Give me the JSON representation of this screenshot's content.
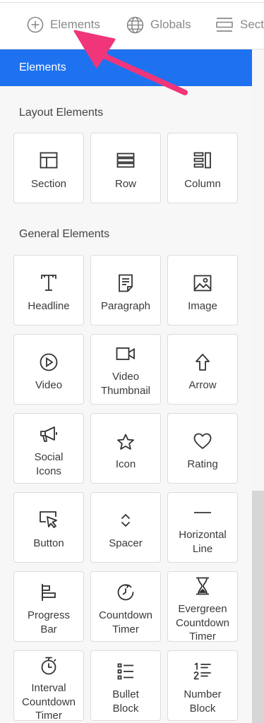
{
  "tabs": [
    {
      "label": "Elements",
      "icon": "plus-circle-icon"
    },
    {
      "label": "Globals",
      "icon": "globe-icon"
    },
    {
      "label": "Secti",
      "icon": "sections-icon"
    }
  ],
  "panel_header": "Elements",
  "layout_section": {
    "title": "Layout Elements",
    "items": [
      {
        "label": "Section",
        "icon": "section-icon"
      },
      {
        "label": "Row",
        "icon": "row-icon"
      },
      {
        "label": "Column",
        "icon": "column-icon"
      }
    ]
  },
  "general_section": {
    "title": "General Elements",
    "items": [
      {
        "label": "Headline",
        "icon": "headline-icon"
      },
      {
        "label": "Paragraph",
        "icon": "paragraph-icon"
      },
      {
        "label": "Image",
        "icon": "image-icon"
      },
      {
        "label": "Video",
        "icon": "video-play-icon"
      },
      {
        "label": "Video\nThumbnail",
        "icon": "video-camera-icon"
      },
      {
        "label": "Arrow",
        "icon": "arrow-up-icon"
      },
      {
        "label": "Social\nIcons",
        "icon": "megaphone-icon"
      },
      {
        "label": "Icon",
        "icon": "star-icon"
      },
      {
        "label": "Rating",
        "icon": "heart-icon"
      },
      {
        "label": "Button",
        "icon": "cursor-button-icon"
      },
      {
        "label": "Spacer",
        "icon": "spacer-icon"
      },
      {
        "label": "Horizontal\nLine",
        "icon": "horizontal-line-icon"
      },
      {
        "label": "Progress\nBar",
        "icon": "progress-bar-icon"
      },
      {
        "label": "Countdown\nTimer",
        "icon": "countdown-timer-icon"
      },
      {
        "label": "Evergreen\nCountdown\nTimer",
        "icon": "hourglass-icon"
      },
      {
        "label": "Interval\nCountdown\nTimer",
        "icon": "stopwatch-icon"
      },
      {
        "label": "Bullet\nBlock",
        "icon": "bullet-list-icon"
      },
      {
        "label": "Number\nBlock",
        "icon": "numbered-list-icon"
      }
    ]
  },
  "colors": {
    "accent": "#1e72f0",
    "annotation_arrow": "#f0357a"
  }
}
